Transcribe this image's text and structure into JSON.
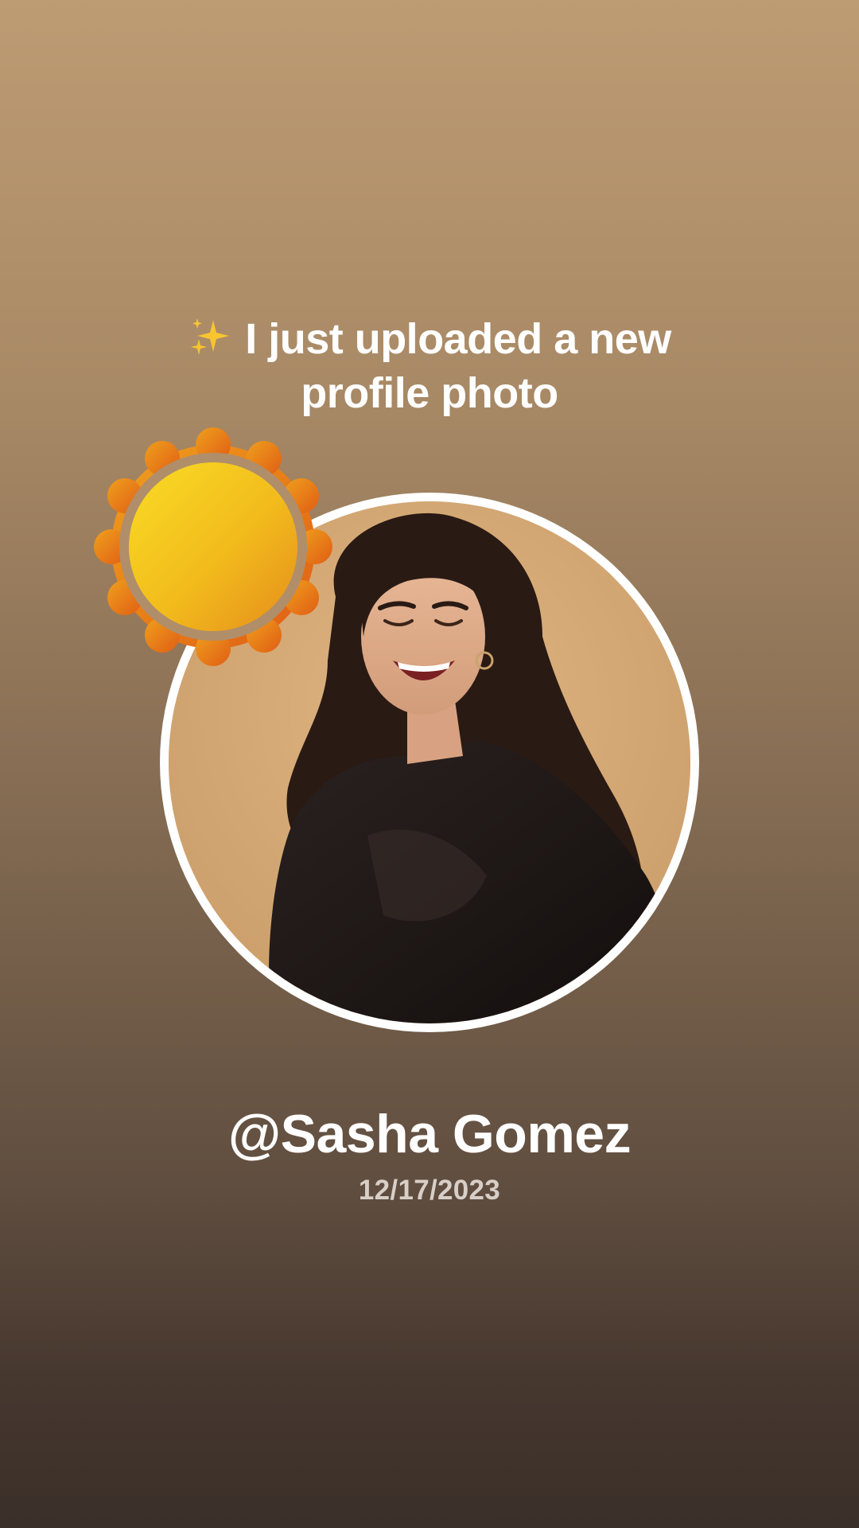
{
  "story": {
    "headline_line1": "I just uploaded a new",
    "headline_line2": "profile photo",
    "headline_emoji": "sparkles-icon",
    "username": "@Sasha Gomez",
    "date": "12/17/2023"
  },
  "colors": {
    "gradient_top": "#bd9b73",
    "gradient_bottom": "#3a2f29",
    "ring": "#ffffff",
    "sun_yellow": "#f4c81e",
    "sun_orange": "#e4711a",
    "date_text": "#d8cfc7"
  },
  "icons": {
    "badge": "sun-badge-icon",
    "sparkle": "sparkles-icon"
  }
}
